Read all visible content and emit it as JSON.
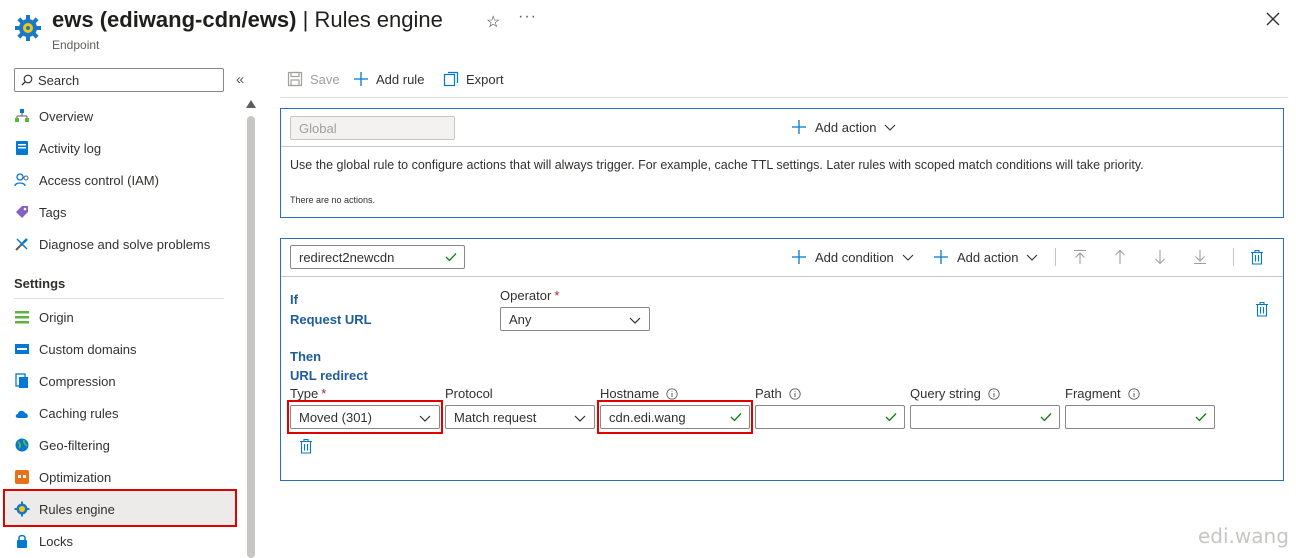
{
  "header": {
    "app_name": "ews (ediwang-cdn/ews)",
    "separator": " | ",
    "page_title": "Rules engine",
    "subtitle": "Endpoint"
  },
  "sidebar": {
    "search_placeholder": "Search",
    "items": [
      {
        "label": "Overview",
        "icon": "overview-icon"
      },
      {
        "label": "Activity log",
        "icon": "activity-log-icon"
      },
      {
        "label": "Access control (IAM)",
        "icon": "iam-icon"
      },
      {
        "label": "Tags",
        "icon": "tag-icon"
      },
      {
        "label": "Diagnose and solve problems",
        "icon": "wrench-icon"
      }
    ],
    "section_title": "Settings",
    "settings_items": [
      {
        "label": "Origin",
        "icon": "origin-icon"
      },
      {
        "label": "Custom domains",
        "icon": "custom-domains-icon"
      },
      {
        "label": "Compression",
        "icon": "compression-icon"
      },
      {
        "label": "Caching rules",
        "icon": "cloud-icon"
      },
      {
        "label": "Geo-filtering",
        "icon": "globe-icon"
      },
      {
        "label": "Optimization",
        "icon": "optimization-icon"
      },
      {
        "label": "Rules engine",
        "icon": "gear-icon",
        "active": true
      },
      {
        "label": "Locks",
        "icon": "lock-icon"
      }
    ]
  },
  "toolbar": {
    "save": "Save",
    "add_rule": "Add rule",
    "export": "Export"
  },
  "global_rule": {
    "name": "Global",
    "add_action": "Add action",
    "description": "Use the global rule to configure actions that will always trigger. For example, cache TTL settings. Later rules with scoped match conditions will take priority.",
    "no_actions": "There are no actions."
  },
  "rule": {
    "name": "redirect2newcdn",
    "add_condition": "Add condition",
    "add_action": "Add action",
    "if_label": "If",
    "condition_name": "Request URL",
    "operator_label": "Operator",
    "operator_value": "Any",
    "then_label": "Then",
    "action_name": "URL redirect",
    "type_label": "Type",
    "type_value": "Moved (301)",
    "protocol_label": "Protocol",
    "protocol_value": "Match request",
    "hostname_label": "Hostname",
    "hostname_value": "cdn.edi.wang",
    "path_label": "Path",
    "path_value": "",
    "query_label": "Query string",
    "query_value": "",
    "fragment_label": "Fragment",
    "fragment_value": ""
  },
  "watermark": "edi.wang",
  "colors": {
    "accent": "#0078d4",
    "panel_border": "#2b6db8",
    "highlight_red": "#e00000",
    "valid_green": "#107c10"
  }
}
